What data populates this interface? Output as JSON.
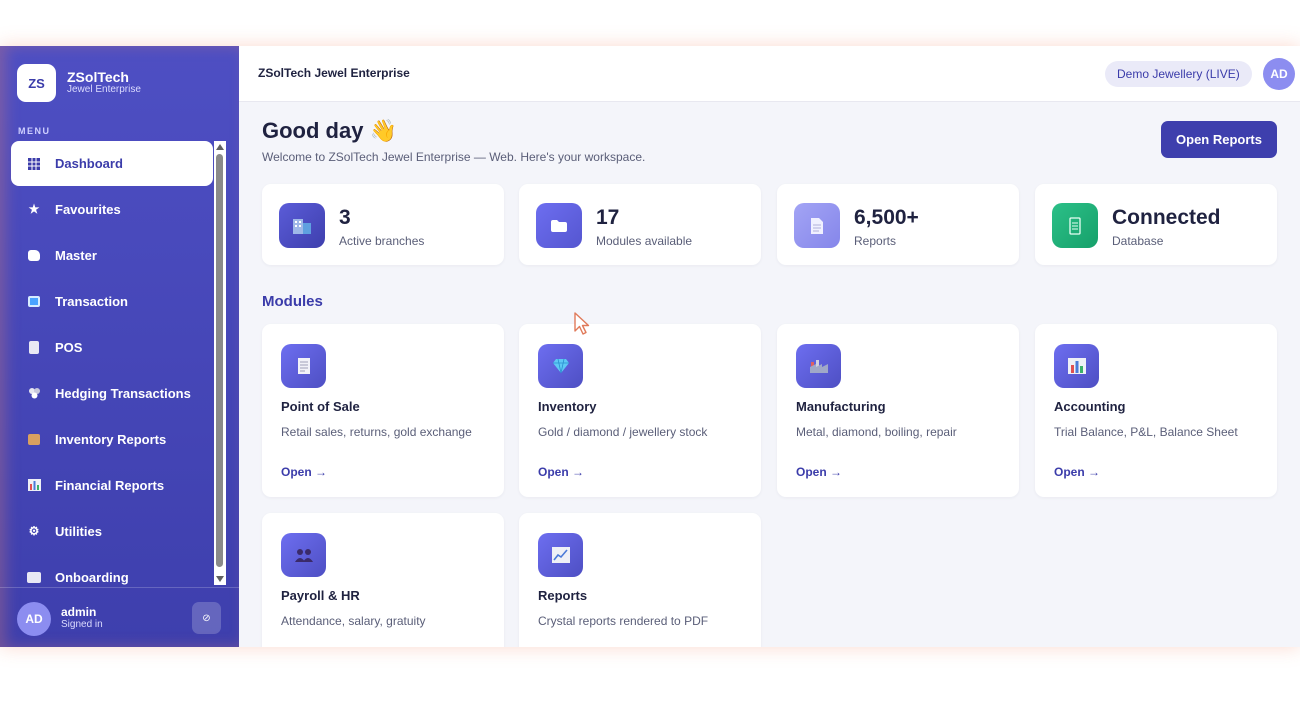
{
  "brand": {
    "logo": "ZS",
    "name": "ZSolTech",
    "sub": "Jewel Enterprise"
  },
  "sidebar": {
    "menu_label": "MENU",
    "items": [
      {
        "label": "Dashboard",
        "icon": "grid-icon"
      },
      {
        "label": "Favourites",
        "icon": "star-icon"
      },
      {
        "label": "Master",
        "icon": "folder-icon"
      },
      {
        "label": "Transaction",
        "icon": "transfer-icon"
      },
      {
        "label": "POS",
        "icon": "receipt-icon"
      },
      {
        "label": "Hedging Transactions",
        "icon": "coins-icon"
      },
      {
        "label": "Inventory Reports",
        "icon": "box-icon"
      },
      {
        "label": "Financial Reports",
        "icon": "bar-chart-icon"
      },
      {
        "label": "Utilities",
        "icon": "gear-icon"
      },
      {
        "label": "Onboarding",
        "icon": "onboarding-icon"
      }
    ],
    "user": {
      "avatar": "AD",
      "name": "admin",
      "status": "Signed in"
    }
  },
  "topbar": {
    "title": "ZSolTech Jewel Enterprise",
    "env": "Demo Jewellery (LIVE)",
    "avatar": "AD"
  },
  "main": {
    "greeting": "Good day 👋",
    "welcome": "Welcome to ZSolTech Jewel Enterprise — Web. Here's your workspace.",
    "open_reports": "Open Reports",
    "stats": [
      {
        "value": "3",
        "label": "Active branches"
      },
      {
        "value": "17",
        "label": "Modules available"
      },
      {
        "value": "6,500+",
        "label": "Reports"
      },
      {
        "value": "Connected",
        "label": "Database"
      }
    ],
    "modules_title": "Modules",
    "modules": [
      {
        "title": "Point of Sale",
        "desc": "Retail sales, returns, gold exchange",
        "open": "Open →"
      },
      {
        "title": "Inventory",
        "desc": "Gold / diamond / jewellery stock",
        "open": "Open →"
      },
      {
        "title": "Manufacturing",
        "desc": "Metal, diamond, boiling, repair",
        "open": "Open →"
      },
      {
        "title": "Accounting",
        "desc": "Trial Balance, P&L, Balance Sheet",
        "open": "Open →"
      },
      {
        "title": "Payroll & HR",
        "desc": "Attendance, salary, gratuity",
        "open": ""
      },
      {
        "title": "Reports",
        "desc": "Crystal reports rendered to PDF",
        "open": ""
      }
    ]
  },
  "colors": {
    "primary": "#3e3fad",
    "accent": "#6d6ef0",
    "success": "#1fae74",
    "background": "#f4f5fa"
  }
}
